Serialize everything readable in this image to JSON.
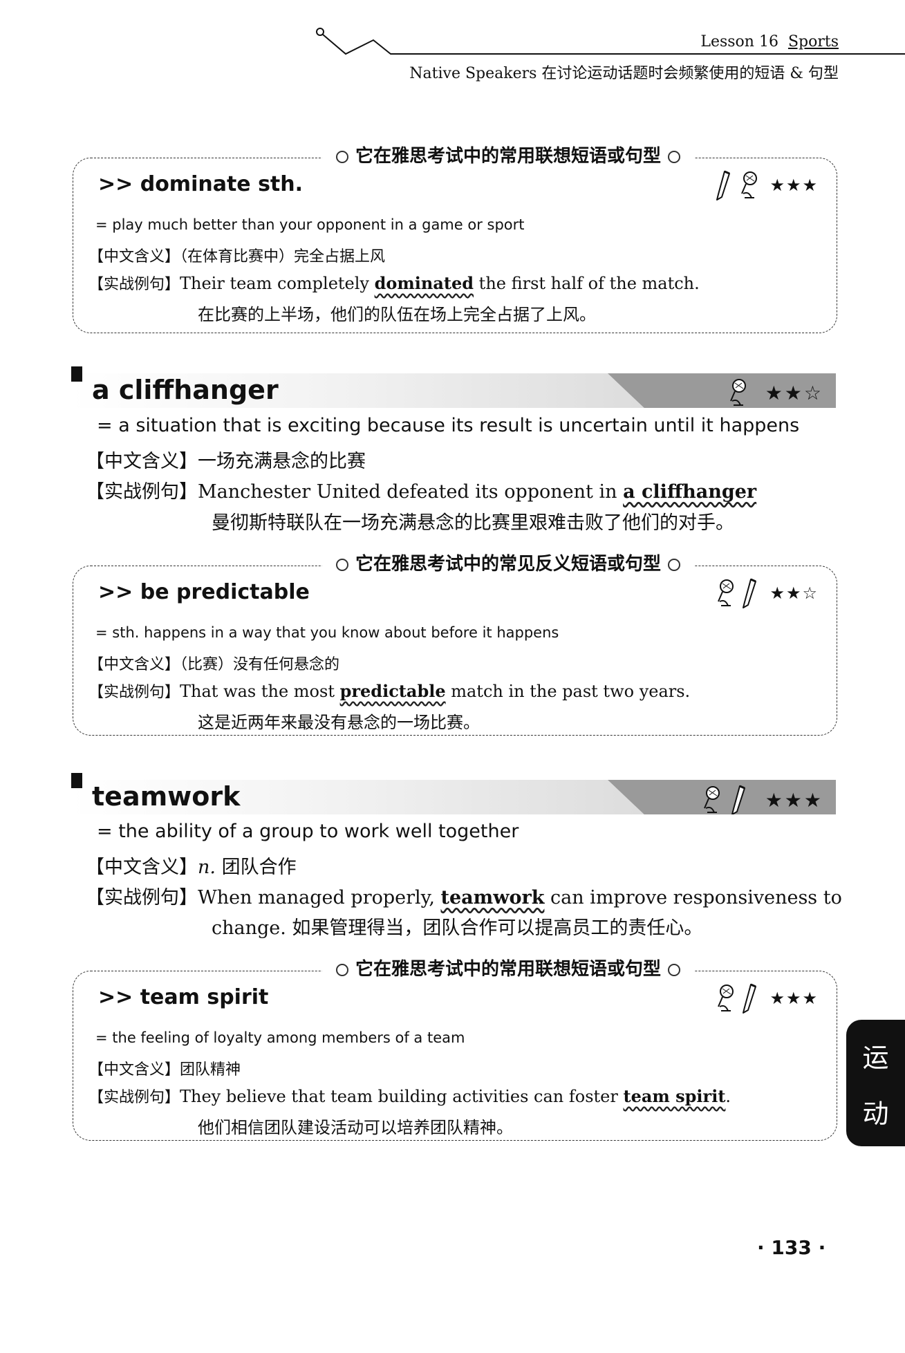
{
  "header": {
    "lesson": "Lesson 16",
    "topic": "Sports",
    "subtitle": "Native Speakers 在讨论运动话题时会频繁使用的短语 & 句型"
  },
  "labels": {
    "chinese_meaning": "【中文含义】",
    "example": "【实战例句】"
  },
  "entries": [
    {
      "box_title": "它在雅思考试中的常用联想短语或句型",
      "heading": ">> dominate sth.",
      "stars": "★★★",
      "definition": "= play much better than your opponent in a game or sport",
      "chinese": "（在体育比赛中）完全占据上风",
      "example_before": "Their team completely ",
      "example_key": "dominated",
      "example_after": " the first half of the match.",
      "translation": "在比赛的上半场，他们的队伍在场上完全占据了上风。"
    },
    {
      "heading": "a cliffhanger",
      "stars": "★★☆",
      "definition": "= a situation that is exciting because its result is uncertain until it happens",
      "chinese": "一场充满悬念的比赛",
      "example_before": "Manchester United defeated its opponent in ",
      "example_key": "a cliffhanger",
      "example_after": "",
      "translation": "曼彻斯特联队在一场充满悬念的比赛里艰难击败了他们的对手。"
    },
    {
      "box_title": "它在雅思考试中的常见反义短语或句型",
      "heading": ">> be predictable",
      "stars": "★★☆",
      "definition": "= sth. happens in a way that you know about before it happens",
      "chinese": "（比赛）没有任何悬念的",
      "example_before": "That was the most ",
      "example_key": "predictable",
      "example_after": " match in the past two years.",
      "translation": "这是近两年来最没有悬念的一场比赛。"
    },
    {
      "heading": "teamwork",
      "stars": "★★★",
      "definition": "= the ability of a group to work well together",
      "pos": "n.",
      "chinese": "团队合作",
      "example_before": "When managed properly, ",
      "example_key": "teamwork",
      "example_after": " can improve responsiveness to",
      "example_line2": "change. 如果管理得当，团队合作可以提高员工的责任心。"
    },
    {
      "box_title": "它在雅思考试中的常用联想短语或句型",
      "heading": ">> team spirit",
      "stars": "★★★",
      "definition": "= the feeling of loyalty among members of a team",
      "chinese": "团队精神",
      "example_before": "They believe that team building activities can foster ",
      "example_key": "team spirit",
      "example_after": ".",
      "translation": "他们相信团队建设活动可以培养团队精神。"
    }
  ],
  "side_tab": [
    "运",
    "动"
  ],
  "page_number": "· 133 ·"
}
